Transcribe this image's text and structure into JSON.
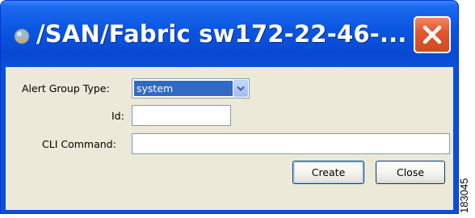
{
  "window": {
    "title": "/SAN/Fabric sw172-22-46-..."
  },
  "form": {
    "alert_group_type_label": "Alert Group Type:",
    "alert_group_type_value": "system",
    "id_label": "Id:",
    "id_value": "",
    "cli_command_label": "CLI Command:",
    "cli_command_value": ""
  },
  "buttons": {
    "create_label": "Create",
    "close_label": "Close"
  },
  "figure_id": "183045",
  "icons": {
    "app": "java-app-icon",
    "close": "close-x-icon",
    "dropdown": "chevron-down-icon"
  },
  "colors": {
    "titlebar": "#0a55e0",
    "close_button": "#e2582f",
    "dialog_background": "#ece9d8",
    "selection": "#316ac5"
  }
}
